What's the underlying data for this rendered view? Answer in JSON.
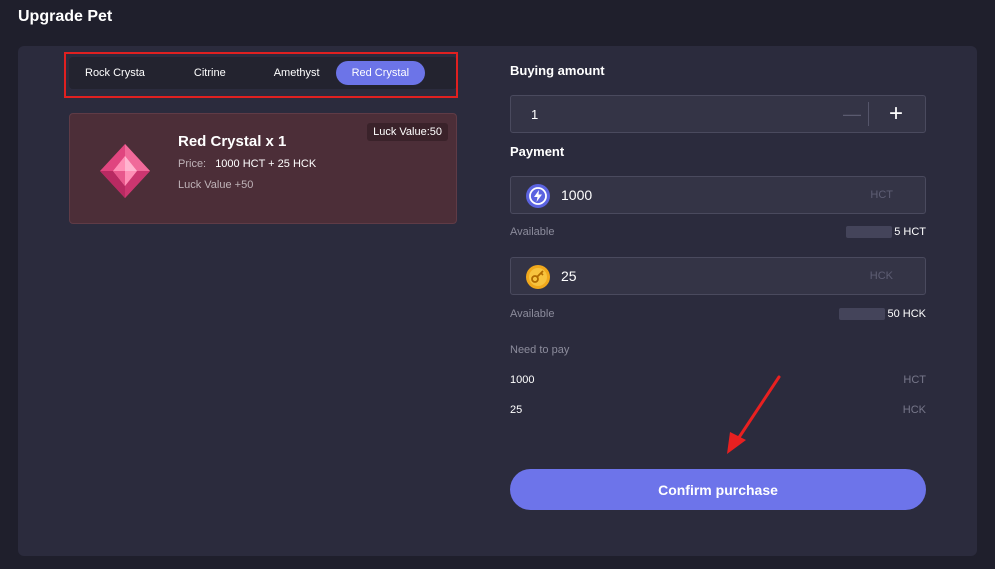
{
  "page": {
    "title": "Upgrade Pet"
  },
  "tabs": [
    {
      "label": "Rock Crysta",
      "active": false
    },
    {
      "label": "Citrine",
      "active": false
    },
    {
      "label": "Amethyst",
      "active": false
    },
    {
      "label": "Red Crystal",
      "active": true
    }
  ],
  "product": {
    "title": "Red Crystal x 1",
    "price_label": "Price:",
    "price_value": "1000 HCT + 25 HCK",
    "luck_text": "Luck Value +50",
    "luck_badge": "Luck Value:50",
    "icon": "red-crystal-gem-icon"
  },
  "buying": {
    "label": "Buying amount",
    "value": "1",
    "minus_symbol": "—",
    "plus_symbol": "+"
  },
  "payment": {
    "label": "Payment",
    "hct": {
      "value": "1000",
      "unit": "HCT",
      "available_label": "Available",
      "available_suffix": "5 HCT",
      "icon": "hct-coin-icon"
    },
    "hck": {
      "value": "25",
      "unit": "HCK",
      "available_label": "Available",
      "available_suffix": "50 HCK",
      "icon": "hck-key-coin-icon"
    }
  },
  "need_to_pay": {
    "label": "Need to pay",
    "rows": [
      {
        "amount": "1000",
        "unit": "HCT"
      },
      {
        "amount": "25",
        "unit": "HCK"
      }
    ]
  },
  "confirm": {
    "label": "Confirm purchase"
  },
  "colors": {
    "accent": "#6c74e8",
    "highlight_box": "#e02020",
    "card_bg": "#4c2e38",
    "panel_bg": "#2b2b3d"
  }
}
